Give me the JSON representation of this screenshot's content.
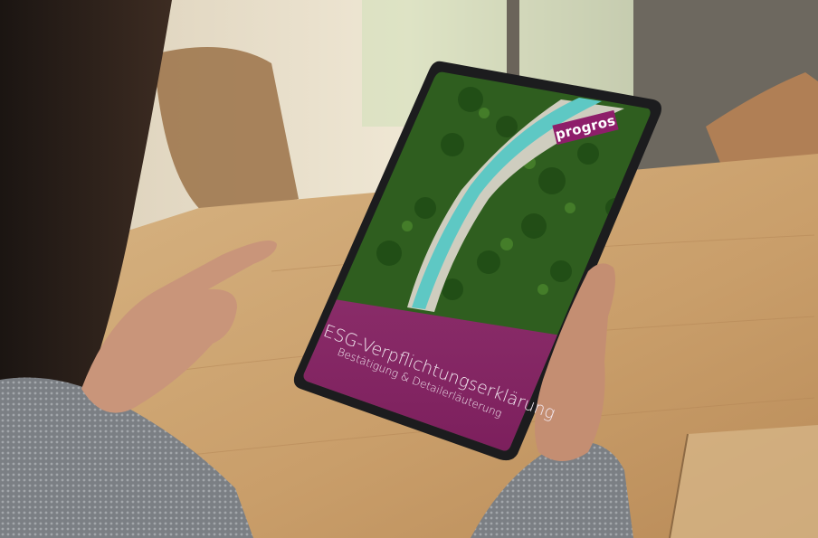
{
  "screen": {
    "logo": "progros",
    "title": "ESG-Verpflichtungserklärung",
    "subtitle": "Bestätigung & Detailerläuterung"
  },
  "colors": {
    "brand_magenta": "#8e1e6a",
    "forest_green": "#2f5e1f",
    "river_turquoise": "#5ec8c4",
    "table_wood": "#cfa978"
  },
  "icons": []
}
